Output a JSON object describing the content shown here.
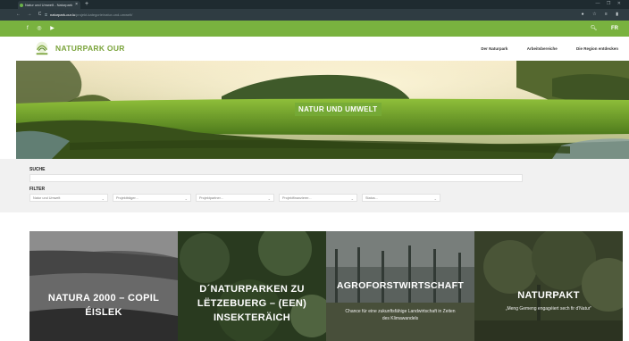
{
  "browser": {
    "tab_title": "Natur und Umwelt - Naturpark",
    "tab_close": "×",
    "new_tab": "+",
    "window_controls": "—  ❐  ✕",
    "nav": "←  →  C",
    "url_host": "naturpark-our.lu",
    "url_path": "/projekt-kategorie/natur-und-umwelt/",
    "toolbar_icons": "●  ☆  ≡  ▮"
  },
  "topbar": {
    "social": "f  ◎  ▶",
    "search_icon": "🔍︎",
    "language": "FR"
  },
  "header": {
    "logo_text": "NATURPARK OUR",
    "logo_small": "naturpark",
    "nav": [
      "Der Naturpark",
      "Arbeitsbereiche",
      "Die Region entdecken"
    ]
  },
  "hero": {
    "title": "NATUR UND UMWELT"
  },
  "filters": {
    "search_label": "SUCHE",
    "filter_label": "FILTER",
    "selects": [
      "Natur und Umwelt",
      "Projektträger...",
      "Projektpartner...",
      "Projektfinanzierer...",
      "Status..."
    ]
  },
  "cards": [
    {
      "title": "NATURA 2000 – COPIL ÉISLEK",
      "subtitle": ""
    },
    {
      "title": "D´NATURPARKEN ZU LËTZEBUERG – (EEN) INSEKTERÄICH",
      "subtitle": ""
    },
    {
      "title": "AGROFORSTWIRTSCHAFT",
      "subtitle": "Chance für eine zukunftsfähige Landwirtschaft in Zeiten des Klimawandels"
    },
    {
      "title": "NATURPAKT",
      "subtitle": "„Meng Gemeng engagéiert sech fir d'Natur\""
    }
  ],
  "colors": {
    "brand_green": "#79b23f",
    "browser_dark": "#1f2b30"
  }
}
